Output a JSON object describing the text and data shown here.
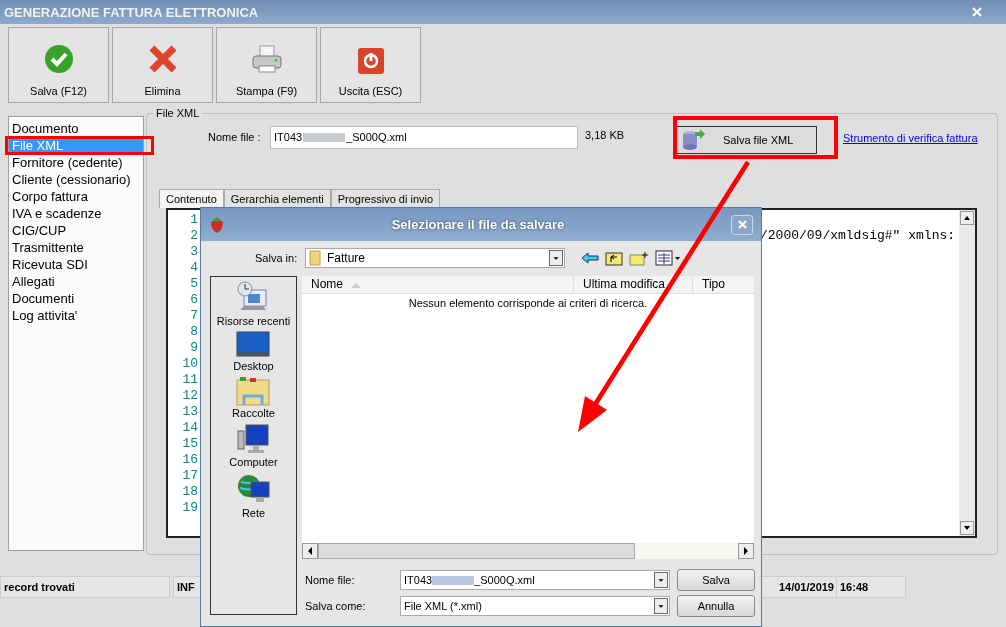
{
  "window": {
    "title": "GENERAZIONE FATTURA ELETTRONICA"
  },
  "toolbar": [
    {
      "label": "Salva (F12)",
      "kind": "save"
    },
    {
      "label": "Elimina",
      "kind": "delete"
    },
    {
      "label": "Stampa (F9)",
      "kind": "print"
    },
    {
      "label": "Uscita (ESC)",
      "kind": "exit"
    }
  ],
  "sections": [
    {
      "label": "Documento",
      "selected": false
    },
    {
      "label": "File XML",
      "selected": true
    },
    {
      "label": "Fornitore (cedente)",
      "selected": false
    },
    {
      "label": "Cliente (cessionario)",
      "selected": false
    },
    {
      "label": "Corpo fattura",
      "selected": false
    },
    {
      "label": "IVA e scadenze",
      "selected": false
    },
    {
      "label": "CIG/CUP",
      "selected": false
    },
    {
      "label": "Trasmittente",
      "selected": false
    },
    {
      "label": "Ricevuta SDI",
      "selected": false
    },
    {
      "label": "Allegati",
      "selected": false
    },
    {
      "label": "Documenti",
      "selected": false
    },
    {
      "label": "Log attivita'",
      "selected": false
    }
  ],
  "file_panel": {
    "title": "File XML",
    "name_label": "Nome file :",
    "name_prefix": "IT043",
    "name_suffix": "_S000Q.xml",
    "size": "3,18 KB",
    "save_button": "Salva file XML",
    "verify_link": "Strumento di verifica fattura"
  },
  "tabs": [
    {
      "label": "Contenuto",
      "selected": true
    },
    {
      "label": "Gerarchia elementi",
      "selected": false
    },
    {
      "label": "Progressivo di invio",
      "selected": false
    }
  ],
  "code_lines": [
    {
      "number": "1"
    },
    {
      "number": "2",
      "text": "/2000/09/xmldsig#\" xmlns:"
    },
    {
      "number": "3"
    },
    {
      "number": "4"
    },
    {
      "number": "5"
    },
    {
      "number": "6"
    },
    {
      "number": "7"
    },
    {
      "number": "8"
    },
    {
      "number": "9"
    },
    {
      "number": "10"
    },
    {
      "number": "11"
    },
    {
      "number": "12"
    },
    {
      "number": "13"
    },
    {
      "number": "14"
    },
    {
      "number": "15"
    },
    {
      "number": "16"
    },
    {
      "number": "17"
    },
    {
      "number": "18"
    },
    {
      "number": "19"
    }
  ],
  "status_bar": [
    "record trovati",
    "INF",
    "14/01/2019",
    "16:48"
  ],
  "dialog": {
    "title": "Selezionare il file da salvare",
    "save_in_label": "Salva in:",
    "folder": "Fatture",
    "places": [
      {
        "label": "Risorse recenti",
        "kind": "recent"
      },
      {
        "label": "Desktop",
        "kind": "desktop"
      },
      {
        "label": "Raccolte",
        "kind": "libraries"
      },
      {
        "label": "Computer",
        "kind": "computer"
      },
      {
        "label": "Rete",
        "kind": "network"
      }
    ],
    "columns": [
      "Nome",
      "Ultima modifica",
      "Tipo"
    ],
    "empty_message": "Nessun elemento corrisponde ai criteri di ricerca.",
    "file_name_label": "Nome file:",
    "file_name_prefix": "IT043",
    "file_name_suffix": "_S000Q.xml",
    "type_label": "Salva come:",
    "type": "File XML (*.xml)",
    "buttons": [
      "Salva",
      "Annulla"
    ]
  }
}
